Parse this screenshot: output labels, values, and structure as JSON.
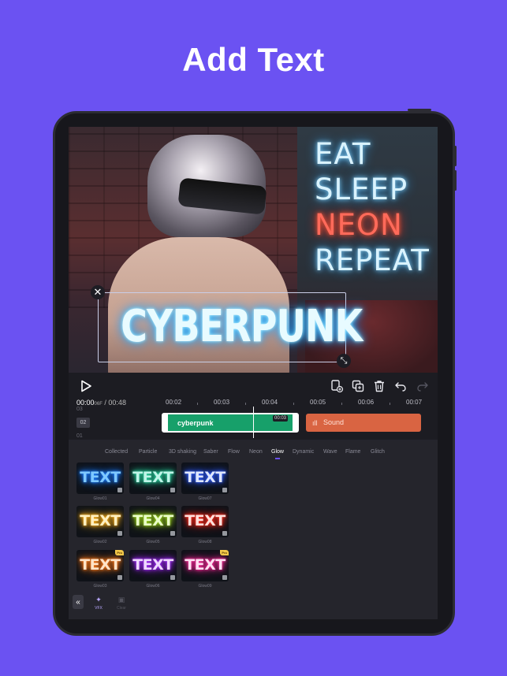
{
  "headline": "Add Text",
  "preview": {
    "neon_lines": [
      "EAT",
      "SLEEP",
      "NEON",
      "REPEAT"
    ],
    "overlay_text": "CYBERPUNK"
  },
  "player": {
    "current_time": "00:00",
    "current_frame": "06F",
    "separator": "/",
    "total_time": "00:48"
  },
  "ruler": [
    "00:02",
    "00:03",
    "00:04",
    "00:05",
    "00:06",
    "00:07"
  ],
  "tracks": {
    "top_number": "03",
    "active_number": "02",
    "bottom_number": "01"
  },
  "clips": {
    "text_clip_label": "cyberpunk",
    "text_clip_stamp": "00:03",
    "sound_clip_label": "Sound"
  },
  "effect_tabs": [
    "Collected",
    "Particle",
    "3D shaking",
    "Saber",
    "Flow",
    "Neon",
    "Glow",
    "Dynamic",
    "Wave",
    "Flame",
    "Glitch"
  ],
  "active_tab": "Glow",
  "presets": [
    {
      "text": "TEXT",
      "name": "Glow01",
      "color": "#7ec8ff",
      "glow": "#1a7bff",
      "vip": ""
    },
    {
      "text": "TEXT",
      "name": "Glow04",
      "color": "#bff5e8",
      "glow": "#2ad6a0",
      "vip": ""
    },
    {
      "text": "TEXT",
      "name": "Glow07",
      "color": "#dfe7ff",
      "glow": "#2f5cff",
      "vip": ""
    },
    {
      "text": "TEXT",
      "name": "Glow02",
      "color": "#fff0c0",
      "glow": "#ffb01a",
      "vip": ""
    },
    {
      "text": "TEXT",
      "name": "Glow05",
      "color": "#eaffc8",
      "glow": "#9ad21a",
      "vip": ""
    },
    {
      "text": "TEXT",
      "name": "Glow08",
      "color": "#ffe0dc",
      "glow": "#ff2a1a",
      "vip": ""
    },
    {
      "text": "TEXT",
      "name": "Glow03",
      "color": "#ffe4c8",
      "glow": "#ff7a1a",
      "vip": "Pro"
    },
    {
      "text": "TEXT",
      "name": "Glow06",
      "color": "#f0d8ff",
      "glow": "#a52aff",
      "vip": ""
    },
    {
      "text": "TEXT",
      "name": "Glow09",
      "color": "#ffe0f2",
      "glow": "#ff2a9a",
      "vip": "Pro"
    }
  ],
  "bottom_bar": {
    "collapse_icon": "«",
    "vfx_label": "VFX",
    "clear_label": "Clear"
  },
  "colors": {
    "background": "#6b52f2",
    "accent": "#6b52f2",
    "text_clip": "#17a06a",
    "sound_clip": "#d96442"
  }
}
